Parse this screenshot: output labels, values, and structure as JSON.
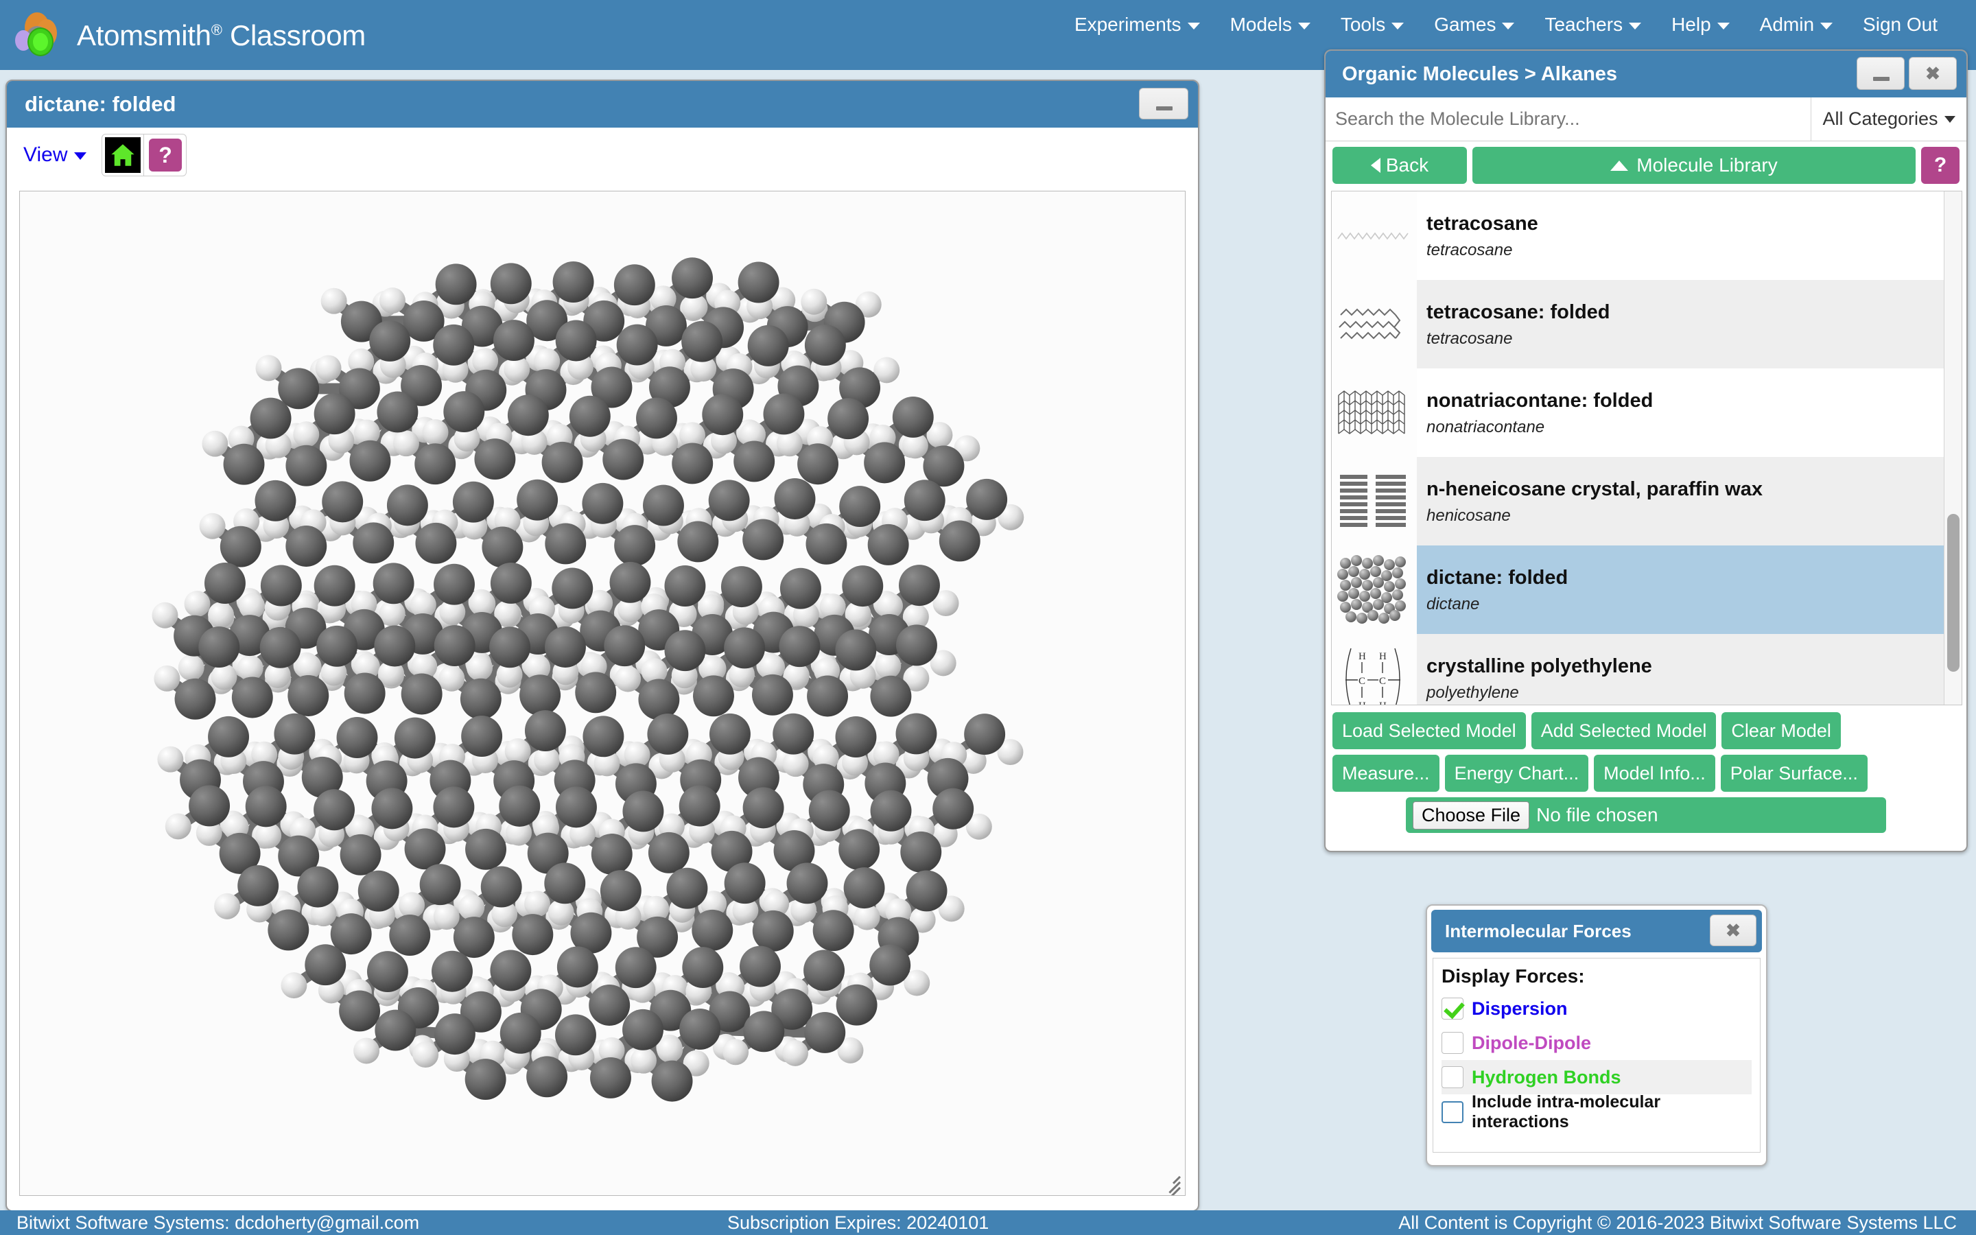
{
  "app": {
    "brand_name": "Atomsmith",
    "brand_trademark": "®",
    "brand_suffix": "Classroom",
    "logo_icon": "atom-cluster-logo"
  },
  "nav": {
    "items": [
      {
        "label": "Experiments",
        "has_caret": true
      },
      {
        "label": "Models",
        "has_caret": true
      },
      {
        "label": "Tools",
        "has_caret": true
      },
      {
        "label": "Games",
        "has_caret": true
      },
      {
        "label": "Teachers",
        "has_caret": true
      },
      {
        "label": "Help",
        "has_caret": true
      },
      {
        "label": "Admin",
        "has_caret": true
      },
      {
        "label": "Sign Out",
        "has_caret": false
      }
    ]
  },
  "model_window": {
    "title": "dictane: folded",
    "minimize_label": "–",
    "toolbar": {
      "view_label": "View",
      "home_icon": "home-icon",
      "help_label": "?"
    }
  },
  "library": {
    "title": "Organic Molecules > Alkanes",
    "minimize_label": "–",
    "close_label": "✖",
    "search_placeholder": "Search the Molecule Library...",
    "search_value": "",
    "category_label": "All Categories",
    "back_label": "Back",
    "library_label": "Molecule Library",
    "help_label": "?",
    "molecules": [
      {
        "name": "tetracosane",
        "formula": "tetracosane",
        "thumb": "zigzag-chain",
        "selected": false
      },
      {
        "name": "tetracosane: folded",
        "formula": "tetracosane",
        "thumb": "folded-zigzag",
        "selected": false
      },
      {
        "name": "nonatriacontane: folded",
        "formula": "nonatriacontane",
        "thumb": "folded-mesh",
        "selected": false
      },
      {
        "name": "n-heneicosane crystal, paraffin wax",
        "formula": "henicosane",
        "thumb": "crystal-stack",
        "selected": false
      },
      {
        "name": "dictane: folded",
        "formula": "dictane",
        "thumb": "space-filling-cluster",
        "selected": true
      },
      {
        "name": "crystalline polyethylene",
        "formula": "polyethylene",
        "thumb": "structural-formula",
        "selected": false
      }
    ],
    "actions_row1": [
      "Load Selected Model",
      "Add Selected Model",
      "Clear Model"
    ],
    "actions_row2": [
      "Measure...",
      "Energy Chart...",
      "Model Info...",
      "Polar Surface..."
    ],
    "file_button_label": "Choose File",
    "file_status": "No file chosen"
  },
  "imf": {
    "title": "Intermolecular Forces",
    "close_label": "✖",
    "heading": "Display Forces:",
    "forces": [
      {
        "label": "Dispersion",
        "color": "#1000ee",
        "checked": true
      },
      {
        "label": "Dipole-Dipole",
        "color": "#c04ac0",
        "checked": false
      },
      {
        "label": "Hydrogen Bonds",
        "color": "#2fd123",
        "checked": false
      }
    ],
    "intra_label": "Include intra-molecular interactions",
    "intra_checked": false
  },
  "footer": {
    "left": "Bitwixt Software Systems: dcdoherty@gmail.com",
    "middle": "Subscription Expires: 20240101",
    "right": "All Content is Copyright © 2016-2023 Bitwixt Software Systems LLC"
  },
  "colors": {
    "brand_blue": "#4282b3",
    "green_button": "#45b97c",
    "magenta_button": "#b1458b",
    "selection_blue": "#acccE3",
    "page_background": "#dce8f0"
  }
}
